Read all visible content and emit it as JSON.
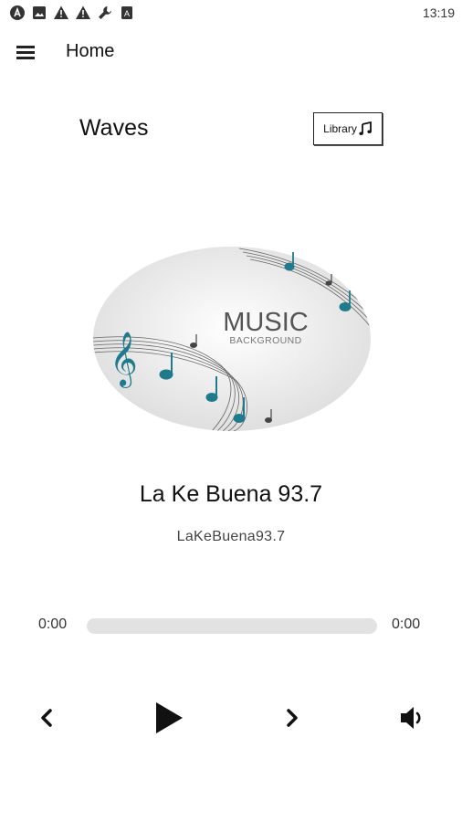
{
  "status_bar": {
    "time": "13:19",
    "icons": [
      "app-a-icon",
      "image-icon",
      "warning-icon",
      "warning-icon",
      "wrench-icon",
      "sim-icon"
    ]
  },
  "app_bar": {
    "title": "Home",
    "menu_icon": "hamburger-menu-icon"
  },
  "header": {
    "brand": "Waves",
    "library_label": "Library",
    "library_icon": "music-note-icon"
  },
  "artwork": {
    "line1": "MUSIC",
    "line2": "BACKGROUND",
    "accent_color": "#1f7a8c"
  },
  "track": {
    "title": "La Ke Buena 93.7",
    "subtitle": "LaKeBuena93.7"
  },
  "progress": {
    "elapsed": "0:00",
    "duration": "0:00",
    "fraction": 0
  },
  "controls": {
    "prev_icon": "chevron-left-icon",
    "play_icon": "play-icon",
    "next_icon": "chevron-right-icon",
    "volume_icon": "volume-icon"
  }
}
